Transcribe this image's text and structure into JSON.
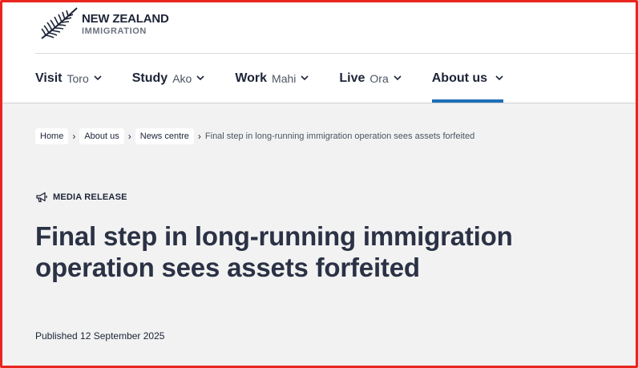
{
  "brand": {
    "name": "NEW ZEALAND",
    "sub": "IMMIGRATION"
  },
  "nav": {
    "items": [
      {
        "en": "Visit",
        "mi": "Toro"
      },
      {
        "en": "Study",
        "mi": "Ako"
      },
      {
        "en": "Work",
        "mi": "Mahi"
      },
      {
        "en": "Live",
        "mi": "Ora"
      },
      {
        "en": "About us",
        "mi": ""
      }
    ],
    "active": "About us",
    "accent": "#1f6fb8"
  },
  "breadcrumb": {
    "items": [
      "Home",
      "About us",
      "News centre"
    ],
    "current": "Final step in long-running immigration operation sees assets forfeited"
  },
  "article": {
    "category_icon": "megaphone-icon",
    "category": "MEDIA RELEASE",
    "title": "Final step in long-running immigration operation sees assets forfeited",
    "published": "Published 12 September 2025"
  }
}
